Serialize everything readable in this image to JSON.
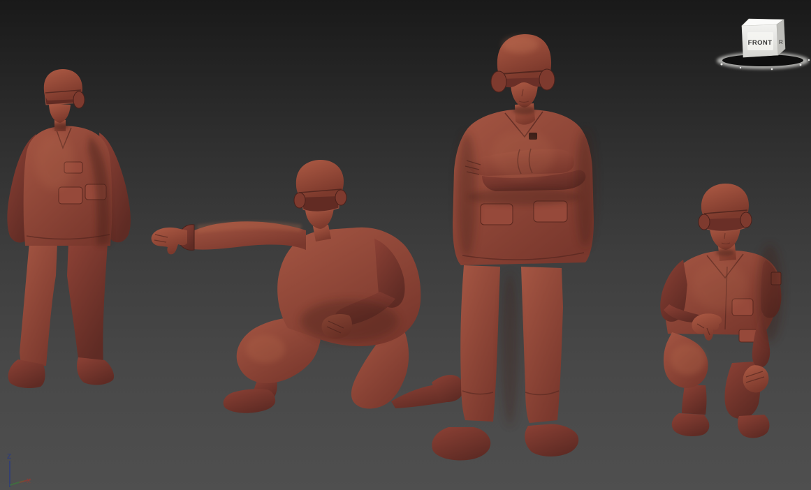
{
  "viewport": {
    "background_top": "#191919",
    "background_bottom": "#4f4f4f",
    "content": "3D sculpting viewport showing four clay soldier figures"
  },
  "view_cube": {
    "front_label": "FRONT",
    "right_label": "R",
    "face_color": "#e9e9e6",
    "text_color": "#3b3b3b"
  },
  "axis_gizmo": {
    "z_label": "Z",
    "x_label": "X",
    "z_color": "#2e3d7a",
    "y_color": "#3a7a3a",
    "x_color": "#97392f"
  },
  "material": {
    "clay_light": "#a85744",
    "clay_base": "#8e4336",
    "clay_dark": "#5e2a23"
  },
  "figures": [
    {
      "name": "soldier-standing-at-ease",
      "pose": "standing, hands behind back, helmet with goggles"
    },
    {
      "name": "soldier-kneeling-pointing",
      "pose": "kneeling on right knee, left arm extended"
    },
    {
      "name": "soldier-standing-arms-crossed",
      "pose": "standing, arms crossed, goggles over eyes"
    },
    {
      "name": "soldier-kneeling-hand-on-knee",
      "pose": "kneeling, hand hanging over raised knee"
    }
  ]
}
